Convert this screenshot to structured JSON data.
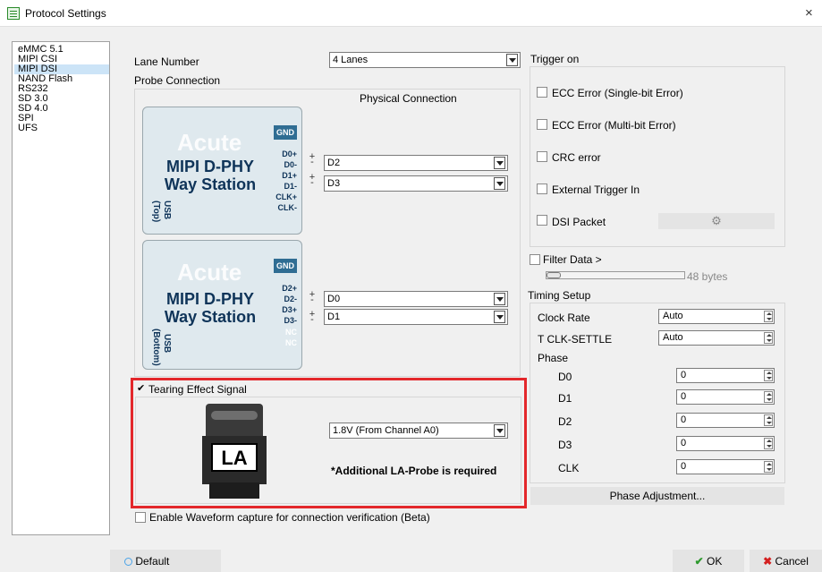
{
  "window": {
    "title": "Protocol Settings",
    "close_glyph": "×"
  },
  "protocols": [
    "eMMC 5.1",
    "MIPI CSI",
    "MIPI DSI",
    "NAND Flash",
    "RS232",
    "SD 3.0",
    "SD 4.0",
    "SPI",
    "UFS"
  ],
  "selected_protocol": "MIPI DSI",
  "lane": {
    "label": "Lane Number",
    "value": "4 Lanes"
  },
  "probe": {
    "label": "Probe Connection",
    "physical_label": "Physical Connection",
    "top": {
      "brand": "Acute",
      "line1": "MIPI D-PHY",
      "line2": "Way Station",
      "usb": "USB",
      "usb_pos": "(Top)",
      "gnd": "GND",
      "pins": [
        "D0+",
        "D0-",
        "D1+",
        "D1-",
        "CLK+",
        "CLK-"
      ],
      "pm": [
        "+",
        "-",
        "+",
        "-"
      ],
      "combos": [
        "D2",
        "D3"
      ]
    },
    "bottom": {
      "brand": "Acute",
      "line1": "MIPI D-PHY",
      "line2": "Way Station",
      "usb": "USB",
      "usb_pos": "(Bottom)",
      "gnd": "GND",
      "pins": [
        "D2+",
        "D2-",
        "D3+",
        "D3-",
        "NC",
        "NC"
      ],
      "pm": [
        "+",
        "-",
        "+",
        "-"
      ],
      "combos": [
        "D0",
        "D1"
      ]
    }
  },
  "tearing": {
    "label": "Tearing Effect Signal",
    "checked": true,
    "la": "LA",
    "voltage": "1.8V (From Channel A0)",
    "note": "*Additional LA-Probe is required"
  },
  "waveform": {
    "label": "Enable Waveform capture for connection verification (Beta)"
  },
  "trigger": {
    "label": "Trigger on",
    "items": [
      "ECC Error (Single-bit Error)",
      "ECC Error (Multi-bit Error)",
      "CRC error",
      "External Trigger In",
      "DSI Packet"
    ]
  },
  "filter": {
    "label": "Filter Data >",
    "size": "48 bytes"
  },
  "timing": {
    "label": "Timing Setup",
    "clock_rate": {
      "label": "Clock Rate",
      "value": "Auto"
    },
    "tclk": {
      "label": "T CLK-SETTLE",
      "value": "Auto"
    },
    "phase_label": "Phase",
    "phases": [
      {
        "label": "D0",
        "value": "0"
      },
      {
        "label": "D1",
        "value": "0"
      },
      {
        "label": "D2",
        "value": "0"
      },
      {
        "label": "D3",
        "value": "0"
      },
      {
        "label": "CLK",
        "value": "0"
      }
    ],
    "phase_button": "Phase Adjustment..."
  },
  "footer": {
    "default": "Default",
    "ok": "OK",
    "cancel": "Cancel"
  },
  "colors": {
    "highlight_border": "#e3272b",
    "ok_check": "#2e9a2e",
    "cancel_x": "#d42020",
    "probe_blue": "#0f3459"
  }
}
